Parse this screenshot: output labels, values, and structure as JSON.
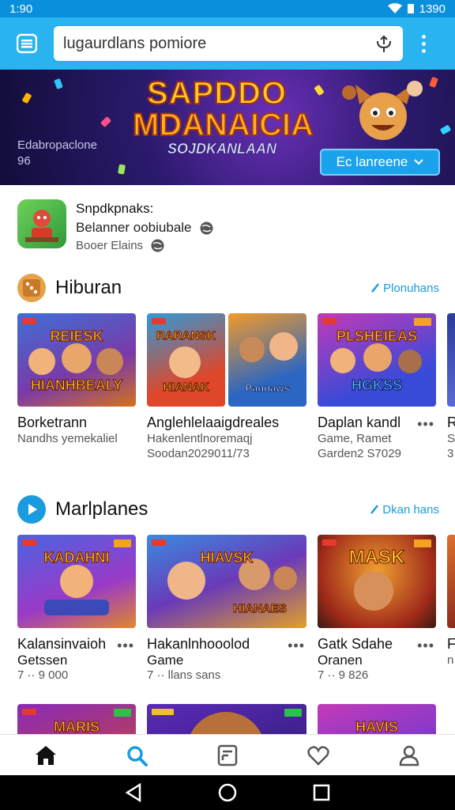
{
  "status": {
    "time": "1:90",
    "right_text": "1390"
  },
  "appbar": {
    "search_value": "lugaurdlans pomiore"
  },
  "banner": {
    "title_line1": "SAPDDO",
    "title_line2": "MDANAICIA",
    "title_line3": "SOJDKANLAAN",
    "sub_line1": "Edabropaclone",
    "sub_line2": "96",
    "cta_label": "Ec lanreene"
  },
  "featured": {
    "name": "Snpdkpnaks:",
    "line1": "Belanner oobiubale",
    "line2": "Booer Elains"
  },
  "sections": [
    {
      "title": "Hiburan",
      "link": "Plonuhans",
      "cards": [
        {
          "art_top": "REIESK",
          "art_bottom": "HIANHBEALY",
          "title": "Borketrann",
          "line1": "Nandhs yemekaliel",
          "line2": ""
        },
        {
          "art_top": "RARANSK",
          "art_bottom": "HIANAK",
          "art3": "Pannaws",
          "title": "Anglehlelaaigdreales",
          "line1": "Hakenlentlnoremaqj",
          "line2": "Soodan2029011/73"
        },
        {
          "art_top": "PLSHEIEAS",
          "art_bottom": "HGKSS",
          "title": "Daplan kandl",
          "line1": "Game, Ramet",
          "line2": "Garden2 S7029"
        },
        {
          "title": "R",
          "line1": "S",
          "line2": "3"
        }
      ]
    },
    {
      "title": "Marlplanes",
      "link": "Dkan hans",
      "cards": [
        {
          "art_top": "KADAHNI",
          "title": "Kalansinvaioh",
          "line1": "Getssen",
          "line2": "7 ·· 9 000"
        },
        {
          "art_top": "HIAVSK",
          "art_bottom": "HIANAES",
          "title": "Hakanlnhooolod",
          "line1": "Game",
          "line2": "7 ·· llans sans"
        },
        {
          "art_top": "MASK",
          "title": "Gatk Sdahe",
          "line1": "Oranen",
          "line2": "7 ·· 9 826"
        },
        {
          "title": "F",
          "line1": "n",
          "line2": ""
        }
      ]
    },
    {
      "cards": [
        {
          "art_top": "MARIS"
        },
        {
          "art_top": ""
        },
        {
          "art_top": "HAVIS"
        }
      ]
    }
  ],
  "icons": {
    "menu": "menu-icon",
    "mic": "mic-icon",
    "more": "more-vert-icon",
    "home": "home-icon",
    "search": "search-icon",
    "library": "library-icon",
    "wishlist": "heart-icon",
    "profile": "profile-icon"
  },
  "colors": {
    "appbar": "#29b3ef",
    "status": "#0a8fdc",
    "accent": "#1a9be0"
  }
}
